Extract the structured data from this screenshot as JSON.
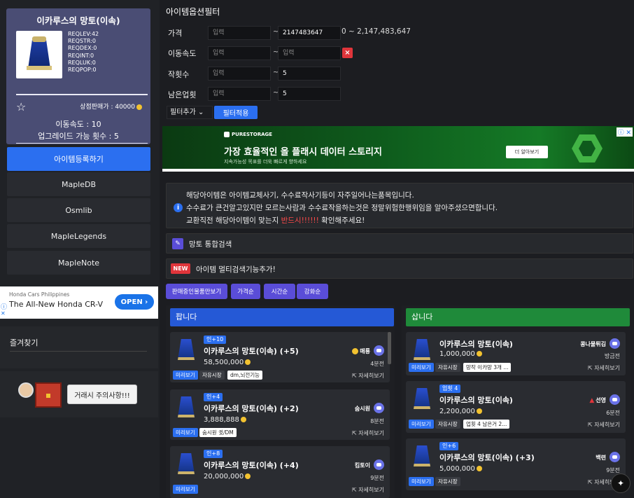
{
  "item": {
    "title": "이카루스의 망토(이속)",
    "stats": [
      "REQLEV:42",
      "REQSTR:0",
      "REQDEX:0",
      "REQINT:0",
      "REQLUK:0",
      "REQPOP:0"
    ],
    "sell_price": "상점판매가 : 40000",
    "speed": "이동속도 : 10",
    "upgrades": "업그레이드 가능 횟수 : 5"
  },
  "left_nav": {
    "register": "아이템등록하기",
    "links": [
      "MapleDB",
      "Osmlib",
      "MapleLegends",
      "MapleNote"
    ]
  },
  "honda_ad": {
    "small": "Honda Cars Philippines",
    "big": "The All-New Honda CR-V",
    "open": "OPEN ›"
  },
  "favorites": {
    "title": "즐겨찾기"
  },
  "warning": {
    "button": "거래시 주의사항!!!"
  },
  "filter": {
    "title": "아이템옵션필터",
    "rows": [
      {
        "label": "가격",
        "min_placeholder": "입력",
        "max_value": "2147483647",
        "note": "0 ~ 2,147,483,647"
      },
      {
        "label": "이동속도",
        "min_placeholder": "입력",
        "max_placeholder": "입력"
      },
      {
        "label": "작횟수",
        "min_placeholder": "입력",
        "max_value": "5"
      },
      {
        "label": "남은업횟",
        "min_placeholder": "입력",
        "max_value": "5"
      }
    ],
    "tilde": "~",
    "delete": "×",
    "add_select": "필터추가 ⌄",
    "apply": "필터적용"
  },
  "pure_ad": {
    "logo": "PURESTORAGE",
    "headline": "가장 효율적인 올 플래시 데이터 스토리지",
    "sub": "지속가능성 목표를 더욱 빠르게 향하세요",
    "cta": "더 알아보기",
    "ad_choice": "ⓘ ✕"
  },
  "notice": {
    "line1": "해당아이템은 아이템교체사기, 수수료작사기등이 자주일어나는품목입니다.",
    "line2": "수수료가 큰건알고있지만 모르는사람과 수수료작을하는것은 정말위험한행위임을 알아주셨으면합니다.",
    "line3_pre": "교환직전 해당아이템이 맞는지 ",
    "line3_red": "반드시!!!!!!",
    "line3_post": " 확인해주세요!"
  },
  "bars": {
    "search": "망토 통합검색",
    "new_tag": "NEW",
    "multi": "아이템 멀티검색기능추가!"
  },
  "sort_buttons": [
    "판매중인물품만보기",
    "가격순",
    "시간순",
    "강화순"
  ],
  "sell_column": {
    "header": "팝니다",
    "cards": [
      {
        "tag": "인+10",
        "name": "이카루스의 망토(이속) (+5)",
        "price": "58,500,000",
        "seller": "매룡",
        "time": "4분전",
        "buttons": [
          "미리보기",
          "자유시장"
        ],
        "note": "dm,뇌전기능",
        "detail": "⇱ 자세히보기"
      },
      {
        "tag": "인+4",
        "name": "이카루스의 망토(이속) (+2)",
        "price": "3,888,888",
        "seller": "숨시원",
        "time": "8분전",
        "buttons": [
          "미리보기"
        ],
        "note": "숨시원 귓/DM",
        "detail": "⇱ 자세히보기"
      },
      {
        "tag": "인+8",
        "name": "이카루스의 망토(이속) (+4)",
        "price": "20,000,000",
        "seller": "킴토이",
        "time": "9분전",
        "buttons": [
          "미리보기"
        ],
        "note": "",
        "detail": "⇱ 자세히보기"
      }
    ]
  },
  "buy_column": {
    "header": "삽니다",
    "cards": [
      {
        "tag": "",
        "name": "이카루스의 망토(이속)",
        "price": "1,000,000",
        "seller": "콩나물튀김",
        "time": "방금전",
        "buttons": [
          "미리보기",
          "자유시장"
        ],
        "note": "망작 이카망 3개 ...",
        "detail": "⇱ 자세히보기"
      },
      {
        "tag": "업횟 4",
        "name": "이카루스의 망토(이속)",
        "price": "2,200,000",
        "seller": "선영",
        "time": "6분전",
        "buttons": [
          "미리보기",
          "자유시장"
        ],
        "note": "업횟 4 남은거 2...",
        "detail": "⇱ 자세히보기"
      },
      {
        "tag": "인+6",
        "name": "이카루스의 망토(이속) (+3)",
        "price": "5,000,000",
        "seller": "백련",
        "time": "9분전",
        "buttons": [
          "미리보기",
          "자유시장"
        ],
        "note": "",
        "detail": "⇱ 자세히보기"
      }
    ]
  },
  "colors": {
    "accent": "#2b6ff0",
    "sell_header": "#2559d6",
    "buy_header": "#1f8a3a",
    "purple": "#5a4dd8",
    "danger": "#e0353b"
  }
}
